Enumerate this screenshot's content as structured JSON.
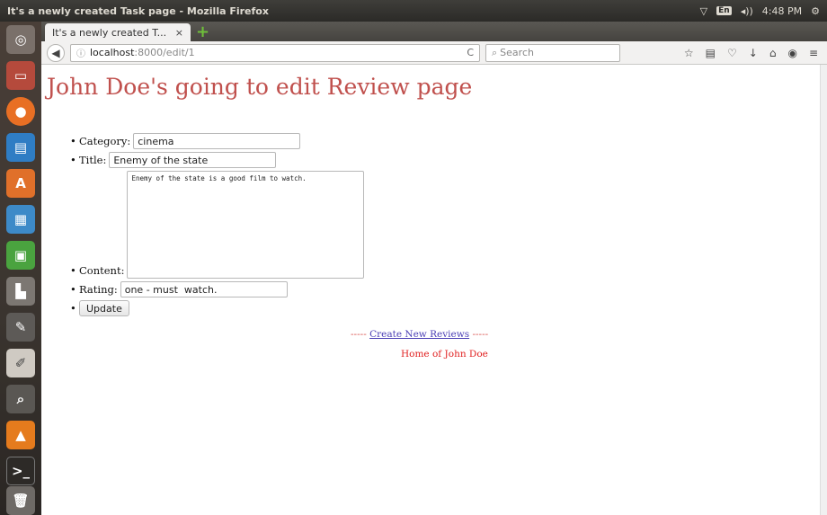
{
  "system": {
    "window_title": "It's a newly created Task page - Mozilla Firefox",
    "lang_badge": "En",
    "volume_glyph": "◂))",
    "clock": "4:48 PM"
  },
  "browser": {
    "tab_label": "It's a newly created T...",
    "tab_close": "×",
    "new_tab": "+",
    "url_host": "localhost",
    "url_path": ":8000/edit/1",
    "reload_glyph": "C",
    "search_placeholder": "Search"
  },
  "page": {
    "heading": "John Doe's going to edit Review page",
    "form": {
      "category_label": "Category:",
      "category_value": "cinema",
      "title_label": "Title:",
      "title_value": "Enemy of the state",
      "content_label": "Content:",
      "content_value": "Enemy of the state is a good film to watch.",
      "rating_label": "Rating:",
      "rating_value": "one - must  watch.",
      "update_label": "Update"
    },
    "footer": {
      "dash_left": "----- ",
      "link_text": "Create New Reviews",
      "dash_right": " -----",
      "home_text": "Home of John Doe"
    }
  },
  "colors": {
    "heading": "#c0504d",
    "link": "#4b3fb5",
    "home_text": "#e02020"
  }
}
